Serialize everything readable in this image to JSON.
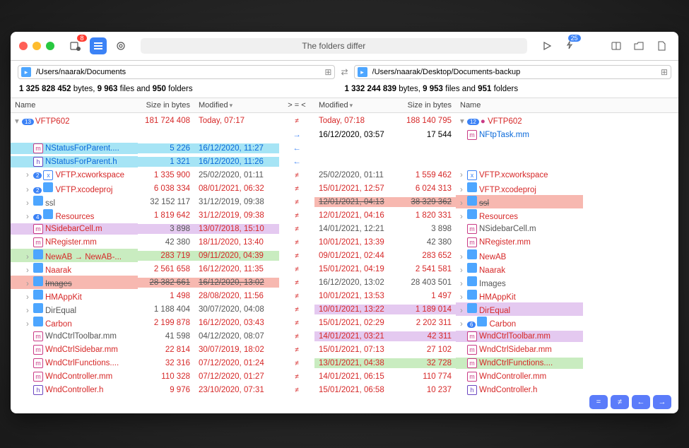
{
  "toolbar": {
    "badge1": "8",
    "badge2": "25",
    "title": "The folders differ"
  },
  "paths": {
    "left": "/Users/naarak/Documents",
    "right": "/Users/naarak/Desktop/Documents-backup"
  },
  "summary": {
    "left_bytes": "1 325 828 452",
    "left_files": "9 963",
    "left_folders": "950",
    "right_bytes": "1 332 244 839",
    "right_files": "9 953",
    "right_folders": "951",
    "bytes_word": "bytes,",
    "files_word": "files and",
    "folders_word": "folders"
  },
  "headers": {
    "name": "Name",
    "size": "Size in bytes",
    "modified": "Modified",
    "diff": "> = <"
  },
  "root": {
    "left_badge": "13",
    "left_name": "VFTP602",
    "left_size": "181 724 408",
    "left_mod": "Today, 07:17",
    "right_mod": "Today, 07:18",
    "right_size": "188 140 795",
    "right_badge": "12",
    "right_name": "VFTP602"
  },
  "rows": [
    {
      "ln": "",
      "ls": "",
      "lm": "",
      "diff": "r",
      "rm": "16/12/2020, 03:57",
      "rs": "17 544",
      "rn": "NFtpTask.mm",
      "rn_ico": "m",
      "rn_cls": "c-blue"
    },
    {
      "lbg": "bg-cyan",
      "ln": "NStatusForParent....",
      "ln_ico": "m",
      "ls": "5 226",
      "lm": "16/12/2020, 11:27",
      "diff": "l",
      "ls_cls": "c-blue",
      "lm_cls": "c-blue",
      "ln_cls": "c-blue"
    },
    {
      "lbg": "bg-cyan",
      "ln": "NStatusForParent.h",
      "ln_ico": "h",
      "ls": "1 321",
      "lm": "16/12/2020, 11:26",
      "diff": "l",
      "ls_cls": "c-blue",
      "lm_cls": "c-blue",
      "ln_cls": "c-blue"
    },
    {
      "exp": ">",
      "ln": "VFTP.xcworkspace",
      "ln_ico": "x",
      "ln_badge": "2",
      "ls": "1 335 900",
      "lm": "25/02/2020, 01:11",
      "diff": "ne",
      "rm": "25/02/2020, 01:11",
      "rs": "1 559 462",
      "rn": "VFTP.xcworkspace",
      "rn_ico": "x",
      "rexp": ">",
      "ln_cls": "c-red",
      "ls_cls": "c-red",
      "lm_cls": "c-gray",
      "rm_cls": "c-gray",
      "rs_cls": "c-red",
      "rn_cls": "c-red"
    },
    {
      "exp": ">",
      "ln": "VFTP.xcodeproj",
      "ln_ico": "folder",
      "ln_badge": "2",
      "ls": "6 038 334",
      "lm": "08/01/2021, 06:32",
      "diff": "ne",
      "rm": "15/01/2021, 12:57",
      "rs": "6 024 313",
      "rn": "VFTP.xcodeproj",
      "rn_ico": "folder",
      "rexp": ">",
      "ln_cls": "c-red",
      "ls_cls": "c-red",
      "lm_cls": "c-red",
      "rm_cls": "c-red",
      "rs_cls": "c-red",
      "rn_cls": "c-red"
    },
    {
      "exp": ">",
      "ln": "ssl",
      "ln_ico": "folder",
      "ls": "32 152 117",
      "lm": "31/12/2019, 09:38",
      "diff": "ne",
      "rbg": "bg-red",
      "rm": "12/01/2021, 04:13",
      "rs": "38 329 362",
      "rn": "ssl",
      "rn_ico": "folder",
      "rexp": ">",
      "ln_cls": "c-gray",
      "ls_cls": "c-gray",
      "lm_cls": "c-gray",
      "rm_cls": "c-gray strike",
      "rs_cls": "c-gray strike",
      "rn_cls": "c-gray strike"
    },
    {
      "exp": ">",
      "ln": "Resources",
      "ln_ico": "folder",
      "ln_badge": "4",
      "ls": "1 819 642",
      "lm": "31/12/2019, 09:38",
      "diff": "ne",
      "rm": "12/01/2021, 04:16",
      "rs": "1 820 331",
      "rn": "Resources",
      "rn_ico": "folder",
      "rexp": ">",
      "ln_cls": "c-red",
      "ls_cls": "c-red",
      "lm_cls": "c-red",
      "rm_cls": "c-red",
      "rs_cls": "c-red",
      "rn_cls": "c-red"
    },
    {
      "lbg": "bg-purple",
      "ln": "NSidebarCell.m",
      "ln_ico": "m",
      "ls": "3 898",
      "lm": "13/07/2018, 15:10",
      "diff": "ne",
      "rm": "14/01/2021, 12:21",
      "rs": "3 898",
      "rn": "NSidebarCell.m",
      "rn_ico": "m",
      "ln_cls": "c-red",
      "ls_cls": "c-gray",
      "lm_cls": "c-red",
      "rm_cls": "c-gray",
      "rs_cls": "c-gray",
      "rn_cls": "c-gray"
    },
    {
      "ln": "NRegister.mm",
      "ln_ico": "m",
      "ls": "42 380",
      "lm": "18/11/2020, 13:40",
      "diff": "ne",
      "rm": "10/01/2021, 13:39",
      "rs": "42 380",
      "rn": "NRegister.mm",
      "rn_ico": "m",
      "ln_cls": "c-red",
      "ls_cls": "c-gray",
      "lm_cls": "c-red",
      "rm_cls": "c-red",
      "rs_cls": "c-gray",
      "rn_cls": "c-red"
    },
    {
      "lbg": "bg-green",
      "exp": ">",
      "ln": "NewAB → NewAB-...",
      "ln_ico": "folder",
      "ls": "283 719",
      "lm": "09/11/2020, 04:39",
      "diff": "ne",
      "rm": "09/01/2021, 02:44",
      "rs": "283 652",
      "rn": "NewAB",
      "rn_ico": "folder",
      "rexp": ">",
      "ln_cls": "c-red",
      "ls_cls": "c-red",
      "lm_cls": "c-red",
      "rm_cls": "c-red",
      "rs_cls": "c-red",
      "rn_cls": "c-red"
    },
    {
      "exp": ">",
      "ln": "Naarak",
      "ln_ico": "folder",
      "ls": "2 561 658",
      "lm": "16/12/2020, 11:35",
      "diff": "ne",
      "rm": "15/01/2021, 04:19",
      "rs": "2 541 581",
      "rn": "Naarak",
      "rn_ico": "folder",
      "rexp": ">",
      "ln_cls": "c-red",
      "ls_cls": "c-red",
      "lm_cls": "c-red",
      "rm_cls": "c-red",
      "rs_cls": "c-red",
      "rn_cls": "c-red"
    },
    {
      "lbg": "bg-red",
      "exp": ">",
      "ln": "Images",
      "ln_ico": "folder",
      "ls": "28 382 661",
      "lm": "16/12/2020, 13:02",
      "diff": "ne",
      "rm": "16/12/2020, 13:02",
      "rs": "28 403 501",
      "rn": "Images",
      "rn_ico": "folder",
      "rexp": ">",
      "ln_cls": "c-gray strike",
      "ls_cls": "c-gray strike",
      "lm_cls": "c-gray strike",
      "rm_cls": "c-gray",
      "rs_cls": "c-gray",
      "rn_cls": "c-gray"
    },
    {
      "exp": ">",
      "ln": "HMAppKit",
      "ln_ico": "folder",
      "ls": "1 498",
      "lm": "28/08/2020, 11:56",
      "diff": "ne",
      "rm": "10/01/2021, 13:53",
      "rs": "1 497",
      "rn": "HMAppKit",
      "rn_ico": "folder",
      "rexp": ">",
      "ln_cls": "c-red",
      "ls_cls": "c-red",
      "lm_cls": "c-red",
      "rm_cls": "c-red",
      "rs_cls": "c-red",
      "rn_cls": "c-red"
    },
    {
      "exp": ">",
      "ln": "DirEqual",
      "ln_ico": "folder",
      "ls": "1 188 404",
      "lm": "30/07/2020, 04:08",
      "diff": "ne",
      "rbg": "bg-purple",
      "rm": "10/01/2021, 13:22",
      "rs": "1 189 014",
      "rn": "DirEqual",
      "rn_ico": "folder",
      "rexp": ">",
      "ln_cls": "c-gray",
      "ls_cls": "c-gray",
      "lm_cls": "c-gray",
      "rm_cls": "c-red",
      "rs_cls": "c-red",
      "rn_cls": "c-red"
    },
    {
      "exp": ">",
      "ln": "Carbon",
      "ln_ico": "folder",
      "ls": "2 199 878",
      "lm": "16/12/2020, 03:43",
      "diff": "ne",
      "rm": "15/01/2021, 02:29",
      "rs": "2 202 311",
      "rn": "Carbon",
      "rn_ico": "folder",
      "rn_badge": "6",
      "rexp": ">",
      "ln_cls": "c-red",
      "ls_cls": "c-red",
      "lm_cls": "c-red",
      "rm_cls": "c-red",
      "rs_cls": "c-red",
      "rn_cls": "c-red"
    },
    {
      "ln": "WndCtrlToolbar.mm",
      "ln_ico": "m",
      "ls": "41 598",
      "lm": "04/12/2020, 08:07",
      "diff": "ne",
      "rbg": "bg-purple",
      "rm": "14/01/2021, 03:21",
      "rs": "42 311",
      "rn": "WndCtrlToolbar.mm",
      "rn_ico": "m",
      "ln_cls": "c-gray",
      "ls_cls": "c-gray",
      "lm_cls": "c-gray",
      "rm_cls": "c-red",
      "rs_cls": "c-red",
      "rn_cls": "c-red"
    },
    {
      "ln": "WndCtrlSidebar.mm",
      "ln_ico": "m",
      "ls": "22 814",
      "lm": "30/07/2019, 18:02",
      "diff": "ne",
      "rm": "15/01/2021, 07:13",
      "rs": "27 102",
      "rn": "WndCtrlSidebar.mm",
      "rn_ico": "m",
      "ln_cls": "c-red",
      "ls_cls": "c-red",
      "lm_cls": "c-red",
      "rm_cls": "c-red",
      "rs_cls": "c-red",
      "rn_cls": "c-red"
    },
    {
      "ln": "WndCtrlFunctions....",
      "ln_ico": "m",
      "ls": "32 316",
      "lm": "07/12/2020, 01:24",
      "diff": "ne",
      "rbg": "bg-green",
      "rm": "13/01/2021, 04:38",
      "rs": "32 728",
      "rn": "WndCtrlFunctions....",
      "rn_ico": "m",
      "ln_cls": "c-red",
      "ls_cls": "c-red",
      "lm_cls": "c-red",
      "rm_cls": "c-red",
      "rs_cls": "c-red",
      "rn_cls": "c-red"
    },
    {
      "ln": "WndController.mm",
      "ln_ico": "m",
      "ls": "110 328",
      "lm": "07/12/2020, 01:27",
      "diff": "ne",
      "rm": "14/01/2021, 06:15",
      "rs": "110 774",
      "rn": "WndController.mm",
      "rn_ico": "m",
      "ln_cls": "c-red",
      "ls_cls": "c-red",
      "lm_cls": "c-red",
      "rm_cls": "c-red",
      "rs_cls": "c-red",
      "rn_cls": "c-red"
    },
    {
      "ln": "WndController.h",
      "ln_ico": "h",
      "ls": "9 976",
      "lm": "23/10/2020, 07:31",
      "diff": "ne",
      "rm": "15/01/2021, 06:58",
      "rs": "10 237",
      "rn": "WndController.h",
      "rn_ico": "h",
      "ln_cls": "c-red",
      "ls_cls": "c-red",
      "lm_cls": "c-red",
      "rm_cls": "c-red",
      "rs_cls": "c-red",
      "rn_cls": "c-red"
    }
  ]
}
